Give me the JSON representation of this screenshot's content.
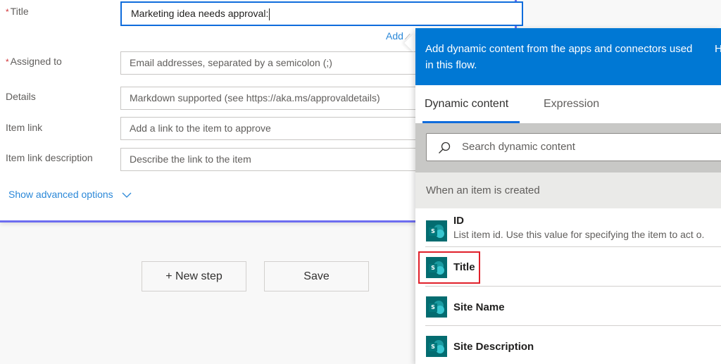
{
  "form": {
    "fields": [
      {
        "label": "Title",
        "required": true,
        "value": "Marketing idea needs approval:",
        "placeholder": ""
      },
      {
        "label": "Assigned to",
        "required": true,
        "value": "",
        "placeholder": "Email addresses, separated by a semicolon (;)"
      },
      {
        "label": "Details",
        "required": false,
        "value": "",
        "placeholder": "Markdown supported (see https://aka.ms/approvaldetails)"
      },
      {
        "label": "Item link",
        "required": false,
        "value": "",
        "placeholder": "Add a link to the item to approve"
      },
      {
        "label": "Item link description",
        "required": false,
        "value": "",
        "placeholder": "Describe the link to the item"
      }
    ],
    "required_marker": "*",
    "add_dynamic_link": "Add",
    "show_advanced": "Show advanced options"
  },
  "buttons": {
    "new_step": "+ New step",
    "save": "Save"
  },
  "dynamic_panel": {
    "header_message": "Add dynamic content from the apps and connectors used in this flow.",
    "header_right": "H",
    "tabs": [
      {
        "label": "Dynamic content",
        "active": true
      },
      {
        "label": "Expression",
        "active": false
      }
    ],
    "search_placeholder": "Search dynamic content",
    "section_title": "When an item is created",
    "items": [
      {
        "title": "ID",
        "description": "List item id. Use this value for specifying the item to act o.",
        "icon": "sharepoint-icon"
      },
      {
        "title": "Title",
        "description": "",
        "icon": "sharepoint-icon",
        "highlighted": true
      },
      {
        "title": "Site Name",
        "description": "",
        "icon": "sharepoint-icon"
      },
      {
        "title": "Site Description",
        "description": "",
        "icon": "sharepoint-icon"
      }
    ],
    "icon_letter": "S"
  },
  "colors": {
    "accent": "#0078d4",
    "card_border": "#6d6df0",
    "highlight_border": "#e0202a",
    "sharepoint": "#036c70"
  }
}
